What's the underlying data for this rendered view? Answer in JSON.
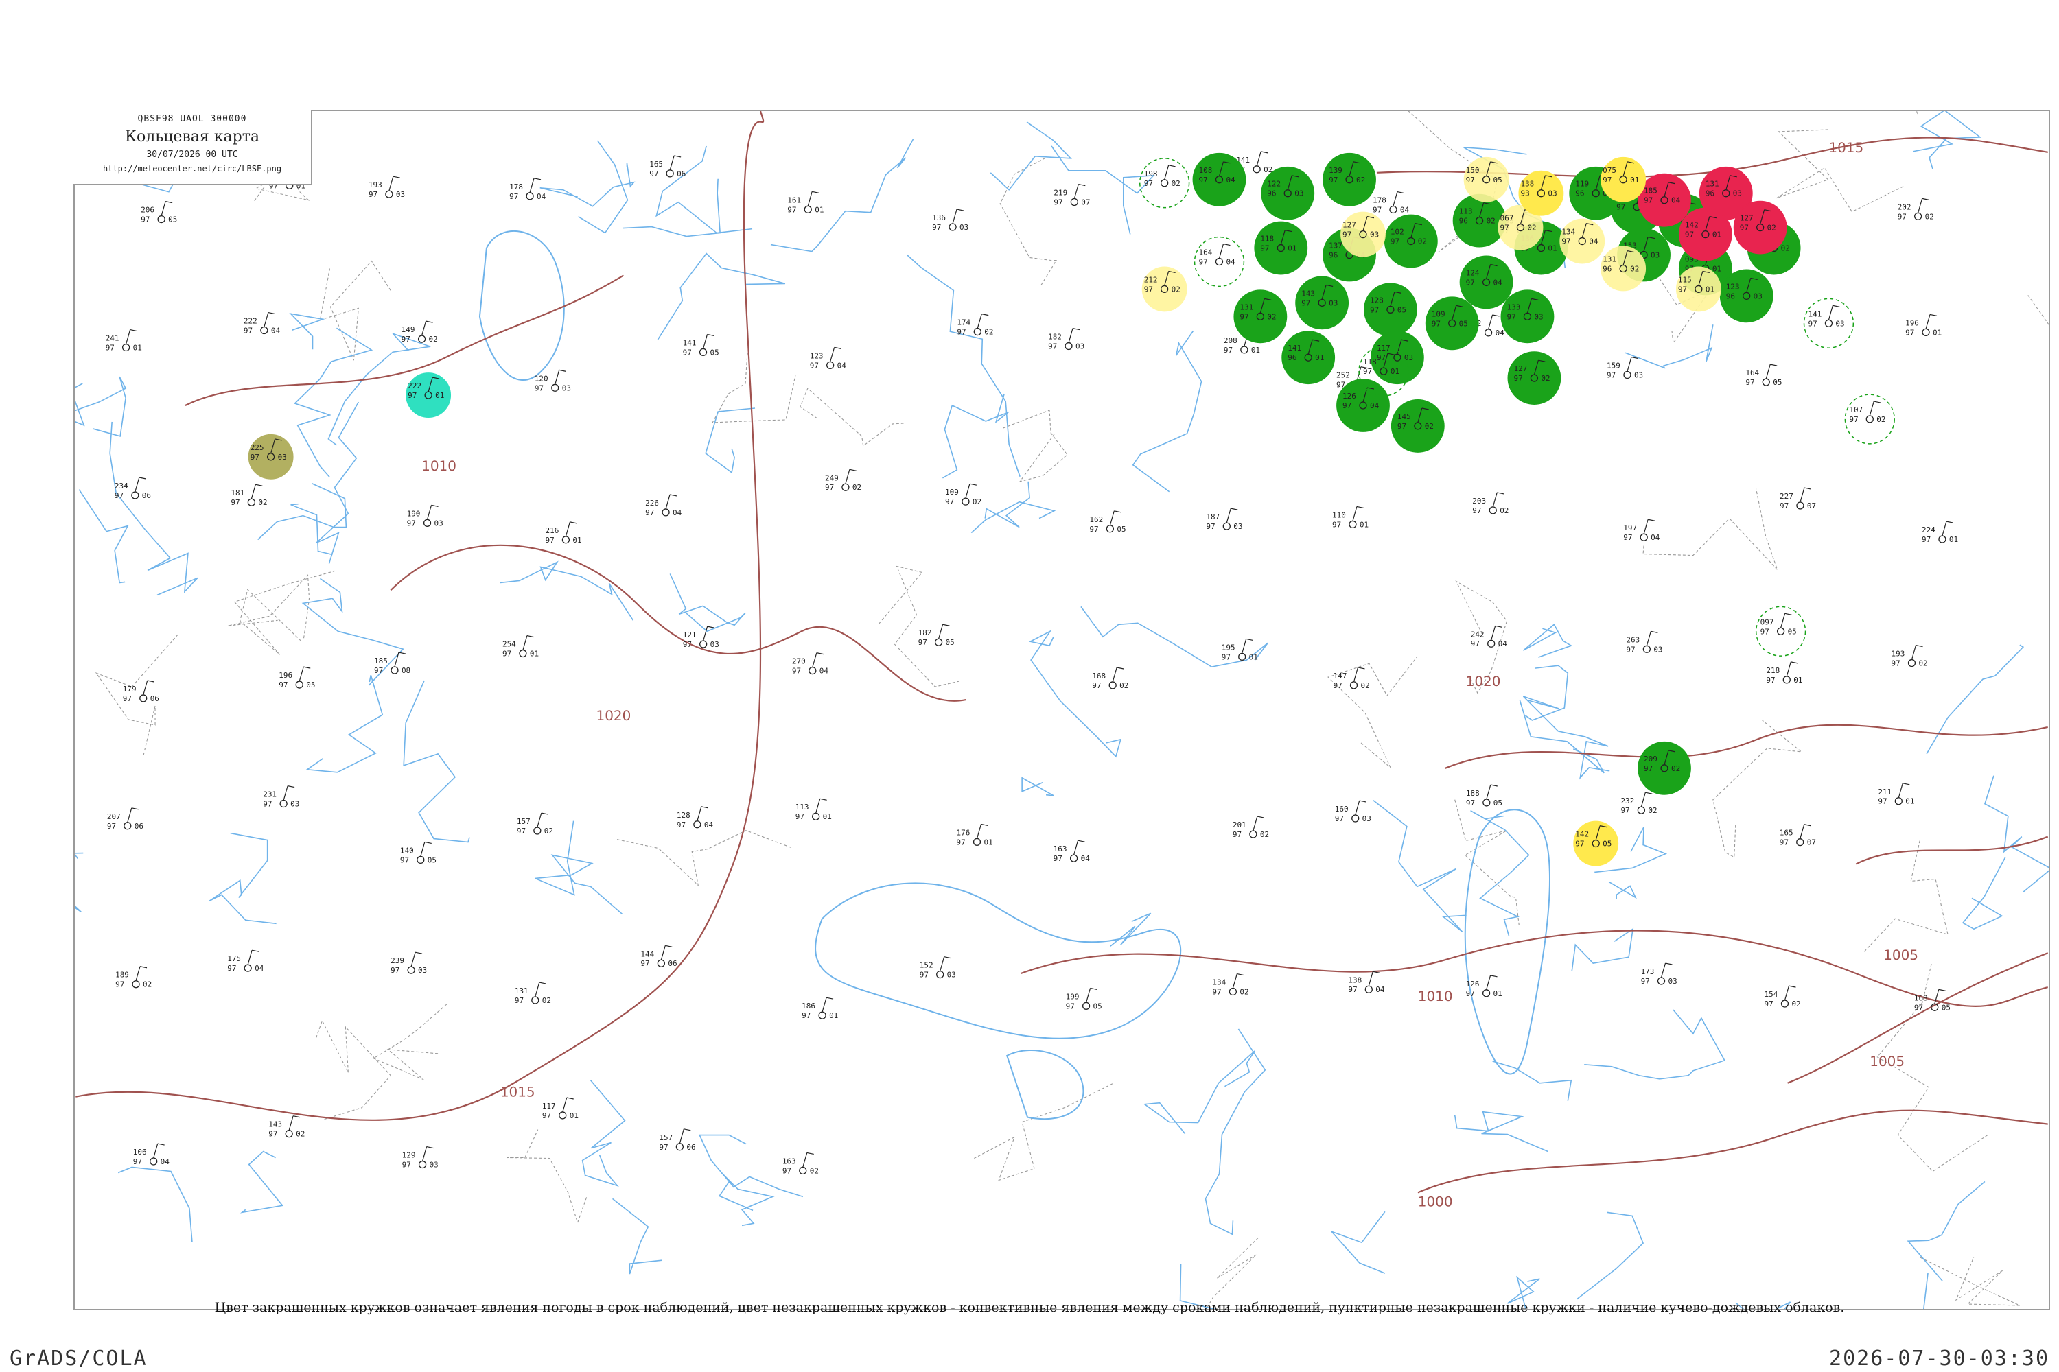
{
  "header": {
    "code": "QBSF98  UAOL  300000",
    "title": "Кольцевая карта",
    "date": "30/07/2026 00 UTC",
    "url": "http://meteocenter.net/circ/LBSF.png"
  },
  "caption": "Цвет закрашенных кружков означает явления погоды в срок наблюдений, цвет незакрашенных кружков - конвективные явления между сроками наблюдений, пунктирные незакрашенные кружки - наличие кучево-дождевых облаков.",
  "footer": {
    "software": "GrADS/COLA",
    "timestamp": "2026-07-30-03:30"
  },
  "colors": {
    "isobar": "#a0524f",
    "river": "#6fb3ea",
    "rain": "#1aa31a",
    "thunder": "#e8244f",
    "fog": "#ffe94d",
    "mist": "#fff59a",
    "drizzle": "#2fe0c0",
    "haze": "#b2b061",
    "frame": "#9a9a9a"
  },
  "isobars": [
    {
      "label": "1015"
    },
    {
      "label": "1020"
    },
    {
      "label": "1010"
    },
    {
      "label": "1005"
    },
    {
      "label": "1000"
    }
  ],
  "stations": [
    {
      "n1": "206",
      "n2": "97",
      "n3": "05",
      "kind": "empty",
      "id": ""
    },
    {
      "n1": "149",
      "n2": "97",
      "n3": "01",
      "kind": "empty",
      "id": ""
    },
    {
      "n1": "193",
      "n2": "97",
      "n3": "03",
      "kind": "empty",
      "id": ""
    },
    {
      "n1": "178",
      "n2": "97",
      "n3": "04",
      "kind": "empty",
      "id": ""
    },
    {
      "n1": "165",
      "n2": "97",
      "n3": "06",
      "kind": "empty",
      "id": ""
    },
    {
      "n1": "161",
      "n2": "97",
      "n3": "01",
      "kind": "empty",
      "id": ""
    },
    {
      "n1": "136",
      "n2": "97",
      "n3": "03",
      "kind": "empty",
      "id": ""
    },
    {
      "n1": "219",
      "n2": "97",
      "n3": "07",
      "kind": "empty",
      "id": ""
    },
    {
      "n1": "141",
      "n2": "97",
      "n3": "02",
      "kind": "empty",
      "id": ""
    },
    {
      "n1": "178",
      "n2": "97",
      "n3": "04",
      "kind": "empty",
      "id": ""
    },
    {
      "n1": "193",
      "n2": "97",
      "n3": "04",
      "kind": "empty",
      "id": ""
    },
    {
      "n1": "150",
      "n2": "97",
      "n3": "02",
      "kind": "empty",
      "id": ""
    },
    {
      "n1": "155",
      "n2": "97",
      "n3": "03",
      "kind": "empty",
      "id": ""
    },
    {
      "n1": "202",
      "n2": "97",
      "n3": "02",
      "kind": "empty",
      "id": ""
    },
    {
      "n1": "241",
      "n2": "97",
      "n3": "01",
      "kind": "empty",
      "id": ""
    },
    {
      "n1": "222",
      "n2": "97",
      "n3": "04",
      "kind": "empty",
      "id": ""
    },
    {
      "n1": "149",
      "n2": "97",
      "n3": "02",
      "kind": "empty",
      "id": ""
    },
    {
      "n1": "120",
      "n2": "97",
      "n3": "03",
      "kind": "empty",
      "id": ""
    },
    {
      "n1": "141",
      "n2": "97",
      "n3": "05",
      "kind": "empty",
      "id": ""
    },
    {
      "n1": "123",
      "n2": "97",
      "n3": "04",
      "kind": "empty",
      "id": ""
    },
    {
      "n1": "174",
      "n2": "97",
      "n3": "02",
      "kind": "empty",
      "id": ""
    },
    {
      "n1": "182",
      "n2": "97",
      "n3": "03",
      "kind": "empty",
      "id": ""
    },
    {
      "n1": "208",
      "n2": "97",
      "n3": "01",
      "kind": "empty",
      "id": ""
    },
    {
      "n1": "252",
      "n2": "97",
      "n3": "02",
      "kind": "empty",
      "id": ""
    },
    {
      "n1": "142",
      "n2": "97",
      "n3": "04",
      "kind": "empty",
      "id": ""
    },
    {
      "n1": "159",
      "n2": "97",
      "n3": "03",
      "kind": "empty",
      "id": ""
    },
    {
      "n1": "164",
      "n2": "97",
      "n3": "05",
      "kind": "empty",
      "id": ""
    },
    {
      "n1": "196",
      "n2": "97",
      "n3": "01",
      "kind": "empty",
      "id": ""
    },
    {
      "n1": "234",
      "n2": "97",
      "n3": "06",
      "kind": "empty",
      "id": ""
    },
    {
      "n1": "181",
      "n2": "97",
      "n3": "02",
      "kind": "empty",
      "id": ""
    },
    {
      "n1": "190",
      "n2": "97",
      "n3": "03",
      "kind": "empty",
      "id": ""
    },
    {
      "n1": "216",
      "n2": "97",
      "n3": "01",
      "kind": "empty",
      "id": ""
    },
    {
      "n1": "226",
      "n2": "97",
      "n3": "04",
      "kind": "empty",
      "id": ""
    },
    {
      "n1": "249",
      "n2": "97",
      "n3": "02",
      "kind": "empty",
      "id": ""
    },
    {
      "n1": "109",
      "n2": "97",
      "n3": "02",
      "kind": "empty",
      "id": ""
    },
    {
      "n1": "162",
      "n2": "97",
      "n3": "05",
      "kind": "empty",
      "id": ""
    },
    {
      "n1": "187",
      "n2": "97",
      "n3": "03",
      "kind": "empty",
      "id": ""
    },
    {
      "n1": "110",
      "n2": "97",
      "n3": "01",
      "kind": "empty",
      "id": ""
    },
    {
      "n1": "203",
      "n2": "97",
      "n3": "02",
      "kind": "empty",
      "id": ""
    },
    {
      "n1": "197",
      "n2": "97",
      "n3": "04",
      "kind": "empty",
      "id": ""
    },
    {
      "n1": "227",
      "n2": "97",
      "n3": "07",
      "kind": "empty",
      "id": ""
    },
    {
      "n1": "224",
      "n2": "97",
      "n3": "01",
      "kind": "empty",
      "id": ""
    },
    {
      "n1": "179",
      "n2": "97",
      "n3": "06",
      "kind": "empty",
      "id": ""
    },
    {
      "n1": "196",
      "n2": "97",
      "n3": "05",
      "kind": "empty",
      "id": ""
    },
    {
      "n1": "185",
      "n2": "97",
      "n3": "08",
      "kind": "empty",
      "id": ""
    },
    {
      "n1": "254",
      "n2": "97",
      "n3": "01",
      "kind": "empty",
      "id": ""
    },
    {
      "n1": "121",
      "n2": "97",
      "n3": "03",
      "kind": "empty",
      "id": ""
    },
    {
      "n1": "270",
      "n2": "97",
      "n3": "04",
      "kind": "empty",
      "id": ""
    },
    {
      "n1": "182",
      "n2": "97",
      "n3": "05",
      "kind": "empty",
      "id": ""
    },
    {
      "n1": "168",
      "n2": "97",
      "n3": "02",
      "kind": "empty",
      "id": ""
    },
    {
      "n1": "195",
      "n2": "97",
      "n3": "01",
      "kind": "empty",
      "id": ""
    },
    {
      "n1": "147",
      "n2": "97",
      "n3": "02",
      "kind": "empty",
      "id": ""
    },
    {
      "n1": "242",
      "n2": "97",
      "n3": "04",
      "kind": "empty",
      "id": ""
    },
    {
      "n1": "263",
      "n2": "97",
      "n3": "03",
      "kind": "empty",
      "id": ""
    },
    {
      "n1": "218",
      "n2": "97",
      "n3": "01",
      "kind": "empty",
      "id": ""
    },
    {
      "n1": "193",
      "n2": "97",
      "n3": "02",
      "kind": "empty",
      "id": ""
    },
    {
      "n1": "207",
      "n2": "97",
      "n3": "06",
      "kind": "empty",
      "id": ""
    },
    {
      "n1": "231",
      "n2": "97",
      "n3": "03",
      "kind": "empty",
      "id": ""
    },
    {
      "n1": "140",
      "n2": "97",
      "n3": "05",
      "kind": "empty",
      "id": ""
    },
    {
      "n1": "157",
      "n2": "97",
      "n3": "02",
      "kind": "empty",
      "id": ""
    },
    {
      "n1": "128",
      "n2": "97",
      "n3": "04",
      "kind": "empty",
      "id": ""
    },
    {
      "n1": "113",
      "n2": "97",
      "n3": "01",
      "kind": "empty",
      "id": ""
    },
    {
      "n1": "176",
      "n2": "97",
      "n3": "01",
      "kind": "empty",
      "id": ""
    },
    {
      "n1": "163",
      "n2": "97",
      "n3": "04",
      "kind": "empty",
      "id": ""
    },
    {
      "n1": "201",
      "n2": "97",
      "n3": "02",
      "kind": "empty",
      "id": ""
    },
    {
      "n1": "160",
      "n2": "97",
      "n3": "03",
      "kind": "empty",
      "id": ""
    },
    {
      "n1": "188",
      "n2": "97",
      "n3": "05",
      "kind": "empty",
      "id": ""
    },
    {
      "n1": "232",
      "n2": "97",
      "n3": "02",
      "kind": "empty",
      "id": ""
    },
    {
      "n1": "165",
      "n2": "97",
      "n3": "07",
      "kind": "empty",
      "id": ""
    },
    {
      "n1": "211",
      "n2": "97",
      "n3": "01",
      "kind": "empty",
      "id": ""
    },
    {
      "n1": "189",
      "n2": "97",
      "n3": "02",
      "kind": "empty",
      "id": ""
    },
    {
      "n1": "175",
      "n2": "97",
      "n3": "04",
      "kind": "empty",
      "id": ""
    },
    {
      "n1": "239",
      "n2": "97",
      "n3": "03",
      "kind": "empty",
      "id": ""
    },
    {
      "n1": "131",
      "n2": "97",
      "n3": "02",
      "kind": "empty",
      "id": ""
    },
    {
      "n1": "144",
      "n2": "97",
      "n3": "06",
      "kind": "empty",
      "id": ""
    },
    {
      "n1": "186",
      "n2": "97",
      "n3": "01",
      "kind": "empty",
      "id": ""
    },
    {
      "n1": "152",
      "n2": "97",
      "n3": "03",
      "kind": "empty",
      "id": ""
    },
    {
      "n1": "199",
      "n2": "97",
      "n3": "05",
      "kind": "empty",
      "id": ""
    },
    {
      "n1": "134",
      "n2": "97",
      "n3": "02",
      "kind": "empty",
      "id": ""
    },
    {
      "n1": "138",
      "n2": "97",
      "n3": "04",
      "kind": "empty",
      "id": ""
    },
    {
      "n1": "126",
      "n2": "97",
      "n3": "01",
      "kind": "empty",
      "id": ""
    },
    {
      "n1": "173",
      "n2": "97",
      "n3": "03",
      "kind": "empty",
      "id": ""
    },
    {
      "n1": "154",
      "n2": "97",
      "n3": "02",
      "kind": "empty",
      "id": ""
    },
    {
      "n1": "168",
      "n2": "97",
      "n3": "05",
      "kind": "empty",
      "id": ""
    },
    {
      "n1": "106",
      "n2": "97",
      "n3": "04",
      "kind": "empty",
      "id": ""
    },
    {
      "n1": "143",
      "n2": "97",
      "n3": "02",
      "kind": "empty",
      "id": ""
    },
    {
      "n1": "129",
      "n2": "97",
      "n3": "03",
      "kind": "empty",
      "id": ""
    },
    {
      "n1": "117",
      "n2": "97",
      "n3": "01",
      "kind": "empty",
      "id": ""
    },
    {
      "n1": "157",
      "n2": "97",
      "n3": "06",
      "kind": "empty",
      "id": ""
    },
    {
      "n1": "163",
      "n2": "97",
      "n3": "02",
      "kind": "empty",
      "id": ""
    },
    {
      "n1": "108",
      "n2": "97",
      "n3": "04",
      "kind": "rain",
      "id": ""
    },
    {
      "n1": "122",
      "n2": "96",
      "n3": "03",
      "kind": "rain",
      "id": ""
    },
    {
      "n1": "139",
      "n2": "97",
      "n3": "02",
      "kind": "rain",
      "id": ""
    },
    {
      "n1": "118",
      "n2": "97",
      "n3": "01",
      "kind": "rain",
      "id": ""
    },
    {
      "n1": "137",
      "n2": "96",
      "n3": "04",
      "kind": "rain",
      "id": ""
    },
    {
      "n1": "102",
      "n2": "97",
      "n3": "02",
      "kind": "rain",
      "id": ""
    },
    {
      "n1": "143",
      "n2": "97",
      "n3": "03",
      "kind": "rain",
      "id": ""
    },
    {
      "n1": "128",
      "n2": "97",
      "n3": "05",
      "kind": "rain",
      "id": ""
    },
    {
      "n1": "113",
      "n2": "96",
      "n3": "02",
      "kind": "rain",
      "id": ""
    },
    {
      "n1": "136",
      "n2": "97",
      "n3": "01",
      "kind": "rain",
      "id": ""
    },
    {
      "n1": "124",
      "n2": "97",
      "n3": "04",
      "kind": "rain",
      "id": ""
    },
    {
      "n1": "117",
      "n2": "97",
      "n3": "03",
      "kind": "rain",
      "id": ""
    },
    {
      "n1": "131",
      "n2": "97",
      "n3": "02",
      "kind": "rain",
      "id": ""
    },
    {
      "n1": "141",
      "n2": "96",
      "n3": "01",
      "kind": "rain",
      "id": ""
    },
    {
      "n1": "109",
      "n2": "97",
      "n3": "05",
      "kind": "rain",
      "id": ""
    },
    {
      "n1": "133",
      "n2": "97",
      "n3": "03",
      "kind": "rain",
      "id": ""
    },
    {
      "n1": "126",
      "n2": "97",
      "n3": "04",
      "kind": "rain",
      "id": ""
    },
    {
      "n1": "145",
      "n2": "97",
      "n3": "02",
      "kind": "rain",
      "id": ""
    },
    {
      "n1": "119",
      "n2": "96",
      "n3": "01",
      "kind": "rain",
      "id": ""
    },
    {
      "n1": "153",
      "n2": "97",
      "n3": "03",
      "kind": "rain",
      "id": ""
    },
    {
      "n1": "127",
      "n2": "97",
      "n3": "02",
      "kind": "rain",
      "id": ""
    },
    {
      "n1": "150",
      "n2": "97",
      "n3": "04",
      "kind": "rain",
      "id": ""
    },
    {
      "n1": "095",
      "n2": "97",
      "n3": "01",
      "kind": "rain",
      "id": ""
    },
    {
      "n1": "123",
      "n2": "96",
      "n3": "03",
      "kind": "rain",
      "id": ""
    },
    {
      "n1": "134",
      "n2": "97",
      "n3": "02",
      "kind": "rain",
      "id": ""
    },
    {
      "n1": "138",
      "n2": "97",
      "n3": "01",
      "kind": "rain",
      "id": ""
    },
    {
      "n1": "209",
      "n2": "97",
      "n3": "02",
      "kind": "rain",
      "id": ""
    },
    {
      "n1": "185",
      "n2": "97",
      "n3": "04",
      "kind": "thunder",
      "id": ""
    },
    {
      "n1": "131",
      "n2": "96",
      "n3": "03",
      "kind": "thunder",
      "id": ""
    },
    {
      "n1": "127",
      "n2": "97",
      "n3": "02",
      "kind": "thunder",
      "id": ""
    },
    {
      "n1": "142",
      "n2": "97",
      "n3": "01",
      "kind": "thunder",
      "id": ""
    },
    {
      "n1": "150",
      "n2": "97",
      "n3": "05",
      "kind": "mist",
      "id": ""
    },
    {
      "n1": "067",
      "n2": "97",
      "n3": "02",
      "kind": "mist",
      "id": ""
    },
    {
      "n1": "138",
      "n2": "93",
      "n3": "03",
      "kind": "fog",
      "id": ""
    },
    {
      "n1": "075",
      "n2": "97",
      "n3": "01",
      "kind": "fog",
      "id": ""
    },
    {
      "n1": "134",
      "n2": "97",
      "n3": "04",
      "kind": "mist",
      "id": ""
    },
    {
      "n1": "131",
      "n2": "96",
      "n3": "02",
      "kind": "mist",
      "id": ""
    },
    {
      "n1": "127",
      "n2": "97",
      "n3": "03",
      "kind": "mist",
      "id": ""
    },
    {
      "n1": "115",
      "n2": "97",
      "n3": "01",
      "kind": "mist",
      "id": ""
    },
    {
      "n1": "212",
      "n2": "97",
      "n3": "02",
      "kind": "mist",
      "id": ""
    },
    {
      "n1": "142",
      "n2": "97",
      "n3": "05",
      "kind": "fog",
      "id": ""
    },
    {
      "n1": "222",
      "n2": "97",
      "n3": "01",
      "kind": "drizzle",
      "id": ""
    },
    {
      "n1": "225",
      "n2": "97",
      "n3": "03",
      "kind": "haze",
      "id": ""
    },
    {
      "n1": "198",
      "n2": "97",
      "n3": "02",
      "kind": "ring",
      "id": ""
    },
    {
      "n1": "164",
      "n2": "97",
      "n3": "04",
      "kind": "ring",
      "id": ""
    },
    {
      "n1": "118",
      "n2": "97",
      "n3": "01",
      "kind": "ring",
      "id": ""
    },
    {
      "n1": "141",
      "n2": "97",
      "n3": "03",
      "kind": "ring",
      "id": ""
    },
    {
      "n1": "107",
      "n2": "97",
      "n3": "02",
      "kind": "ring",
      "id": ""
    },
    {
      "n1": "097",
      "n2": "97",
      "n3": "05",
      "kind": "ring",
      "id": ""
    }
  ]
}
